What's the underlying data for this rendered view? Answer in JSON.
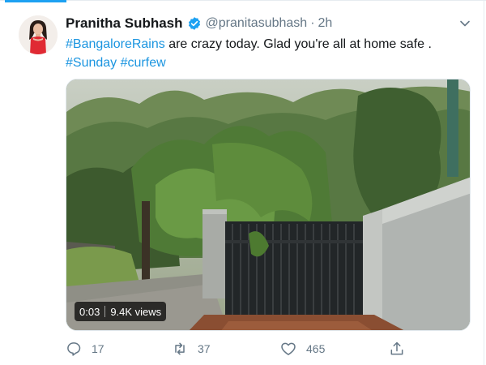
{
  "tweet": {
    "author_name": "Pranitha Subhash",
    "handle": "@pranitasubhash",
    "separator": "·",
    "time": "2h",
    "text": {
      "tag1": "#BangaloreRains",
      "body": " are crazy today. Glad you're all at home safe . ",
      "tag2": "#Sunday",
      "tag3": "#curfew"
    }
  },
  "video": {
    "duration": "0:03",
    "views": "9.4K views"
  },
  "actions": {
    "reply_count": "17",
    "retweet_count": "37",
    "like_count": "465"
  },
  "colors": {
    "accent": "#1da1f2",
    "hashtag": "#1b95e0",
    "muted": "#657786"
  },
  "icons": {
    "verified": "verified-badge-icon",
    "caret": "chevron-down-icon",
    "reply": "reply-icon",
    "retweet": "retweet-icon",
    "like": "heart-icon",
    "share": "share-icon"
  }
}
